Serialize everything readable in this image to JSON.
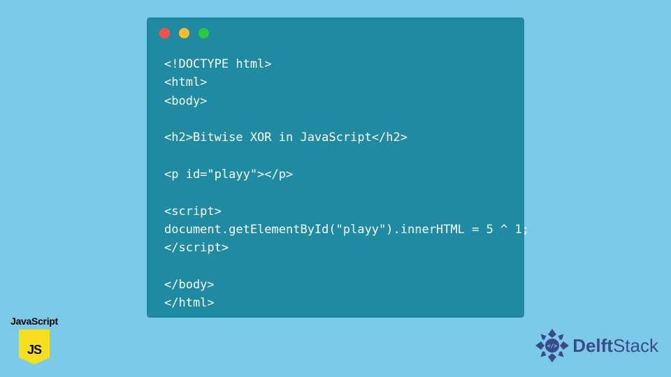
{
  "window": {
    "dots": {
      "red": "#ff4f4a",
      "yellow": "#ffbd2e",
      "green": "#27c93f"
    }
  },
  "code": {
    "lines": [
      "<!DOCTYPE html>",
      "<html>",
      "<body>",
      "",
      "<h2>Bitwise XOR in JavaScript</h2>",
      "",
      "<p id=\"playy\"></p>",
      "",
      "<script>",
      "document.getElementById(\"playy\").innerHTML = 5 ^ 1;",
      "</script>",
      "",
      "</body>",
      "</html>"
    ]
  },
  "badge": {
    "label": "JavaScript",
    "logo_text": "JS"
  },
  "brand": {
    "name_part1": "Delft",
    "name_part2": "Stack",
    "color": "#3a4a8a"
  }
}
